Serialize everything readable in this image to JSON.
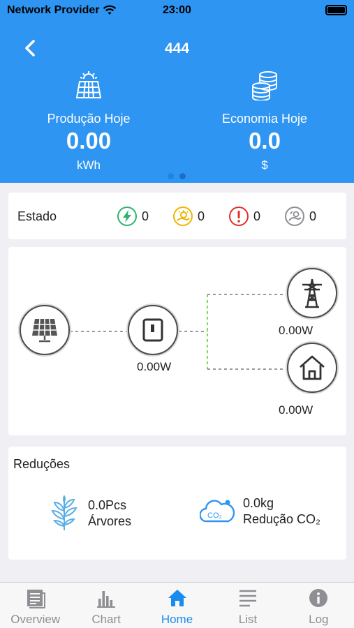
{
  "status_bar": {
    "carrier": "Network Provider",
    "time": "23:00"
  },
  "header": {
    "title": "444"
  },
  "summary": [
    {
      "label": "Produção Hoje",
      "value": "0.00",
      "unit": "kWh",
      "icon": "solar-panel-icon"
    },
    {
      "label": "Economia Hoje",
      "value": "0.0",
      "unit": "$",
      "icon": "coins-icon"
    }
  ],
  "pager": {
    "pages": 2,
    "active": 0
  },
  "state": {
    "label": "Estado",
    "items": [
      {
        "icon": "normal-bolt-icon",
        "count": "0",
        "color": "#2db36b"
      },
      {
        "icon": "standby-sun-icon",
        "count": "0",
        "color": "#f0b400"
      },
      {
        "icon": "fault-alert-icon",
        "count": "0",
        "color": "#e0302b"
      },
      {
        "icon": "offline-icon",
        "count": "0",
        "color": "#8e8e93"
      }
    ]
  },
  "flow": {
    "inverter_value": "0.00W",
    "grid_value": "0.00W",
    "home_value": "0.00W",
    "colors": {
      "line": "#9a9a9a",
      "active_line": "#7ed957"
    }
  },
  "reductions": {
    "title": "Reduções",
    "trees": {
      "value": "0.0Pcs",
      "label": "Árvores"
    },
    "co2": {
      "value": "0.0kg",
      "label": "Redução CO₂"
    }
  },
  "tabs": [
    {
      "label": "Overview",
      "icon": "overview-icon",
      "active": false
    },
    {
      "label": "Chart",
      "icon": "bar-chart-icon",
      "active": false
    },
    {
      "label": "Home",
      "icon": "home-icon",
      "active": true
    },
    {
      "label": "List",
      "icon": "list-icon",
      "active": false
    },
    {
      "label": "Log",
      "icon": "info-icon",
      "active": false
    }
  ],
  "colors": {
    "accent": "#2e95f2",
    "tab_active": "#1a8cf0",
    "tab_inactive": "#8e8e93"
  }
}
